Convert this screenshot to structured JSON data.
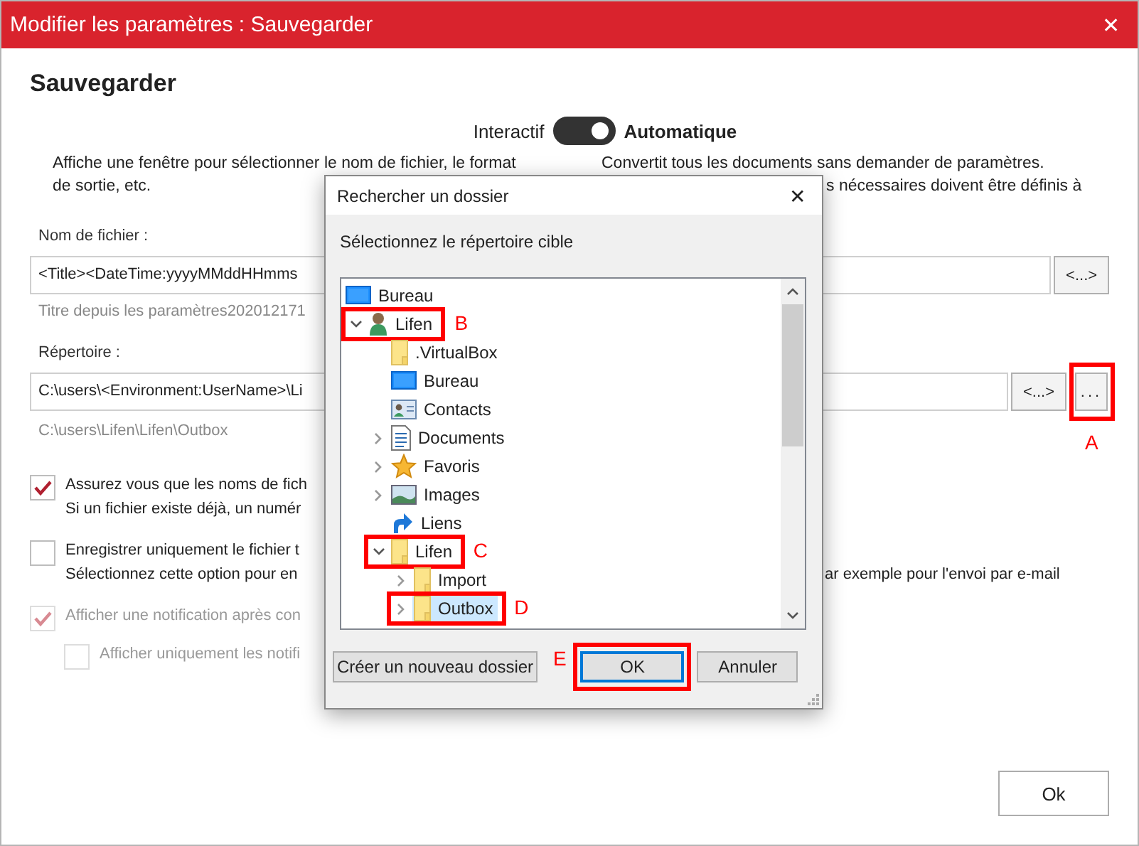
{
  "window": {
    "title": "Modifier les paramètres : Sauvegarder",
    "close": "✕"
  },
  "heading": "Sauvegarder",
  "mode_toggle": {
    "left_label": "Interactif",
    "right_label": "Automatique",
    "on": true
  },
  "descriptions": {
    "left": [
      "Affiche une fenêtre pour sélectionner le nom de fichier, le format",
      "de sortie, etc."
    ],
    "right": [
      "Convertit tous les documents sans demander de paramètres.",
      "s nécessaires doivent être définis à"
    ]
  },
  "filename": {
    "label": "Nom de fichier :",
    "value": "<Title><DateTime:yyyyMMddHHmms",
    "button": "<...>",
    "hint": "Titre depuis les paramètres202012171"
  },
  "directory": {
    "label": "Répertoire :",
    "value": "C:\\users\\<Environment:UserName>\\Li",
    "button": "<...>",
    "browse_button": "...",
    "browse_annotation": "A",
    "hint": "C:\\users\\Lifen\\Lifen\\Outbox"
  },
  "options": [
    {
      "lines": [
        "Assurez vous que les noms de fich",
        "Si un fichier existe déjà, un numér"
      ],
      "checked": true,
      "disabled": false
    },
    {
      "lines": [
        "Enregistrer uniquement le fichier t",
        "Sélectionnez cette option pour en"
      ],
      "tail": "ar exemple pour l'envoi par e-mail",
      "checked": false,
      "disabled": false
    },
    {
      "lines": [
        "Afficher une notification après con"
      ],
      "checked": true,
      "disabled": true,
      "children": [
        {
          "lines": [
            "Afficher uniquement les notifi"
          ],
          "checked": false,
          "disabled": true
        }
      ]
    }
  ],
  "ok_button": "Ok",
  "dialog": {
    "title": "Rechercher un dossier",
    "close": "✕",
    "instruction": "Sélectionnez le répertoire cible",
    "tree": [
      {
        "label": "Bureau",
        "kind": "desktop",
        "expandable": false,
        "expanded": true,
        "selected": false,
        "children": [
          {
            "label": "Lifen",
            "kind": "user",
            "expandable": true,
            "expanded": true,
            "selected": false,
            "annotation": "B",
            "children": [
              {
                "label": ".VirtualBox",
                "kind": "folder",
                "expandable": false,
                "selected": false
              },
              {
                "label": "Bureau",
                "kind": "desktop",
                "expandable": false,
                "selected": false
              },
              {
                "label": "Contacts",
                "kind": "contacts",
                "expandable": false,
                "selected": false
              },
              {
                "label": "Documents",
                "kind": "documents",
                "expandable": true,
                "expanded": false,
                "selected": false
              },
              {
                "label": "Favoris",
                "kind": "star",
                "expandable": true,
                "expanded": false,
                "selected": false
              },
              {
                "label": "Images",
                "kind": "images",
                "expandable": true,
                "expanded": false,
                "selected": false
              },
              {
                "label": "Liens",
                "kind": "link",
                "expandable": false,
                "selected": false
              },
              {
                "label": "Lifen",
                "kind": "folder",
                "expandable": true,
                "expanded": true,
                "selected": false,
                "annotation": "C",
                "children": [
                  {
                    "label": "Import",
                    "kind": "folder",
                    "expandable": true,
                    "expanded": false,
                    "selected": false
                  },
                  {
                    "label": "Outbox",
                    "kind": "folder",
                    "expandable": true,
                    "expanded": false,
                    "selected": true,
                    "annotation": "D"
                  }
                ]
              }
            ]
          }
        ]
      }
    ],
    "new_folder_button": "Créer un nouveau dossier",
    "ok_button": "OK",
    "ok_annotation": "E",
    "cancel_button": "Annuler"
  }
}
